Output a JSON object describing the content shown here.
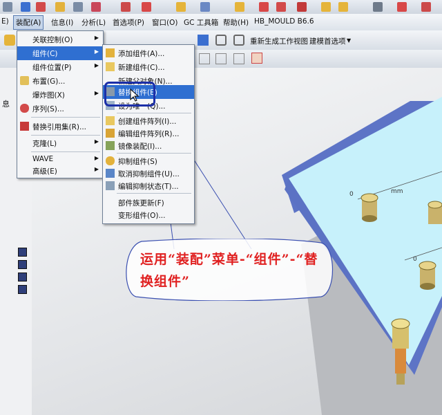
{
  "menubar": {
    "items": [
      "装配(A)",
      "信息(I)",
      "分析(L)",
      "首选项(P)",
      "窗口(O)",
      "GC 工具箱",
      "帮助(H)",
      "HB_MOULD B6.6"
    ],
    "prefix": "E)"
  },
  "toolbar": {
    "regen_label": "重新生成工作视图",
    "modeling_pref_label": "建模首选项"
  },
  "assembly_menu": {
    "items": [
      {
        "label": "关联控制(O)",
        "submenu": true
      },
      {
        "label": "组件(C)",
        "submenu": true,
        "highlighted": true
      },
      {
        "label": "组件位置(P)",
        "submenu": true
      },
      {
        "label": "布置(G)..."
      },
      {
        "label": "爆炸图(X)",
        "submenu": true
      },
      {
        "label": "序列(S)..."
      },
      {
        "label": "替换引用集(R)..."
      },
      {
        "label": "克隆(L)",
        "submenu": true
      },
      {
        "label": "WAVE",
        "submenu": true
      },
      {
        "label": "高级(E)",
        "submenu": true
      }
    ]
  },
  "component_menu": {
    "items": [
      {
        "label": "添加组件(A)..."
      },
      {
        "label": "新建组件(C)..."
      },
      {
        "label": "新建父对象(N)..."
      },
      {
        "label": "替换组件(E)",
        "highlighted": true
      },
      {
        "label": "设为唯一(Q)..."
      },
      {
        "label": "创建组件阵列(I)..."
      },
      {
        "label": "编辑组件阵列(R)..."
      },
      {
        "label": "镜像装配(I)..."
      },
      {
        "label": "抑制组件(S)"
      },
      {
        "label": "取消抑制组件(U)..."
      },
      {
        "label": "编辑抑制状态(T)..."
      },
      {
        "label": "部件族更新(F)"
      },
      {
        "label": "变形组件(O)..."
      }
    ]
  },
  "left_panel": {
    "tab_label": "息"
  },
  "callout": {
    "text": "运用“装配”菜单-“组件”-“替换组件”"
  },
  "viewport": {
    "dim_label_1": "0",
    "dim_label_2": "0",
    "dim_label_3": "0",
    "dim_unit": "mm"
  },
  "colors": {
    "highlight": "#2f6fd1",
    "callout_text": "#e02020",
    "callout_border": "#3a4fb0",
    "plate_top": "#c7f1fb",
    "plate_side": "#5d74c6"
  }
}
